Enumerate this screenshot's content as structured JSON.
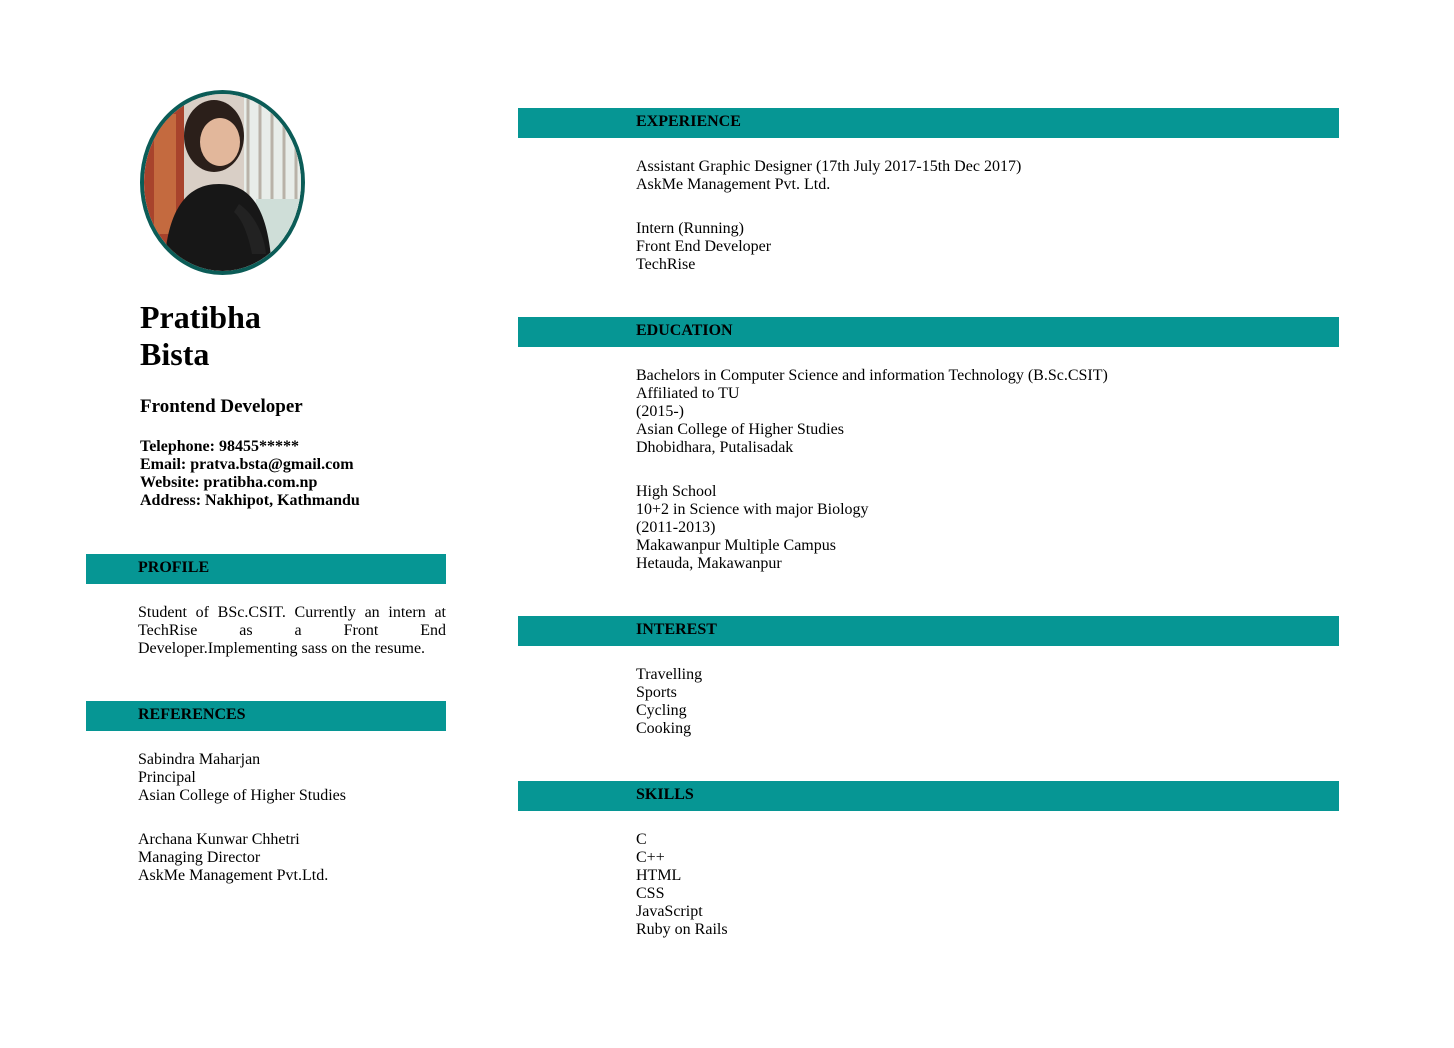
{
  "header": {
    "first_name": "Pratibha",
    "last_name": "Bista",
    "job_title": "Frontend Developer",
    "contact": [
      "Telephone: 98455*****",
      "Email: pratva.bsta@gmail.com",
      "Website: pratibha.com.np",
      "Address: Nakhipot, Kathmandu"
    ]
  },
  "sections": {
    "profile": {
      "title": "PROFILE",
      "text": "Student of BSc.CSIT. Currently an intern at TechRise as a Front End Developer.Implementing sass on the resume."
    },
    "references": {
      "title": "REFERENCES",
      "entries": [
        [
          "Sabindra Maharjan",
          "Principal",
          "Asian College of Higher Studies"
        ],
        [
          "Archana Kunwar Chhetri",
          "Managing Director",
          "AskMe Management Pvt.Ltd."
        ]
      ]
    },
    "experience": {
      "title": "EXPERIENCE",
      "entries": [
        [
          "Assistant Graphic Designer (17th July 2017-15th Dec 2017)",
          "AskMe Management Pvt. Ltd."
        ],
        [
          "Intern (Running)",
          "Front End Developer",
          "TechRise"
        ]
      ]
    },
    "education": {
      "title": "EDUCATION",
      "entries": [
        [
          "Bachelors in Computer Science and information Technology (B.Sc.CSIT)",
          "Affiliated to TU",
          "(2015-)",
          "Asian College of Higher Studies",
          "Dhobidhara, Putalisadak"
        ],
        [
          "High School",
          "10+2 in Science with major Biology",
          "(2011-2013)",
          "Makawanpur Multiple Campus",
          "Hetauda, Makawanpur"
        ]
      ]
    },
    "interest": {
      "title": "INTEREST",
      "items": [
        "Travelling",
        "Sports",
        "Cycling",
        "Cooking"
      ]
    },
    "skills": {
      "title": "SKILLS",
      "items": [
        "C",
        "C++",
        "HTML",
        "CSS",
        "JavaScript",
        "Ruby on Rails"
      ]
    }
  },
  "colors": {
    "band": "#069694",
    "photo_border": "#0b5c57"
  }
}
